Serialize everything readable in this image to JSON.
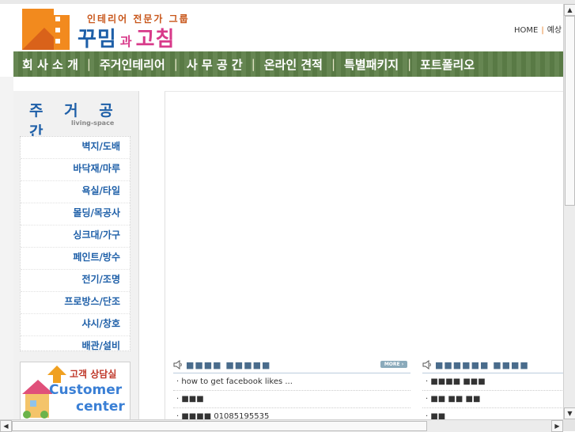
{
  "header": {
    "tagline": "인테리어 전문가 그룹",
    "brand_part1": "꾸밈",
    "brand_conj": "과",
    "brand_part2": "고침",
    "top_links": [
      "HOME",
      "예상"
    ]
  },
  "nav": {
    "items": [
      "회 사 소 개",
      "주거인테리어",
      "사 무 공 간",
      "온라인 견적",
      "특별패키지",
      "포트폴리오"
    ]
  },
  "sidebar": {
    "title": "주 거 공 간",
    "subtitle": "living-space",
    "items": [
      "벽지/도배",
      "바닥재/마루",
      "욕실/타일",
      "몰딩/목공사",
      "싱크대/가구",
      "페인트/방수",
      "전기/조명",
      "프로방스/단조",
      "샤시/창호",
      "배관/설비"
    ],
    "cs_label": "고객 상담실",
    "cs_en_line1": "Customer",
    "cs_en_line2": "center"
  },
  "boards": [
    {
      "title": "■■■■ ■■■■■",
      "more": "MORE",
      "rows": [
        "· how to get facebook likes ...",
        "· ■■■",
        "· ■■■■ 01085195535"
      ]
    },
    {
      "title": "■■■■■■ ■■■■",
      "rows": [
        "· ■■■■ ■■■",
        "· ■■ ■■ ■■",
        "· ■■"
      ]
    }
  ],
  "colors": {
    "nav_bg": "#5e8049",
    "brand_blue": "#1e5fa8",
    "brand_pink": "#d83a8a",
    "tagline_orange": "#c8561a"
  },
  "icons": {
    "board_icon": "speaker-icon",
    "logo": "house-logo-icon"
  }
}
